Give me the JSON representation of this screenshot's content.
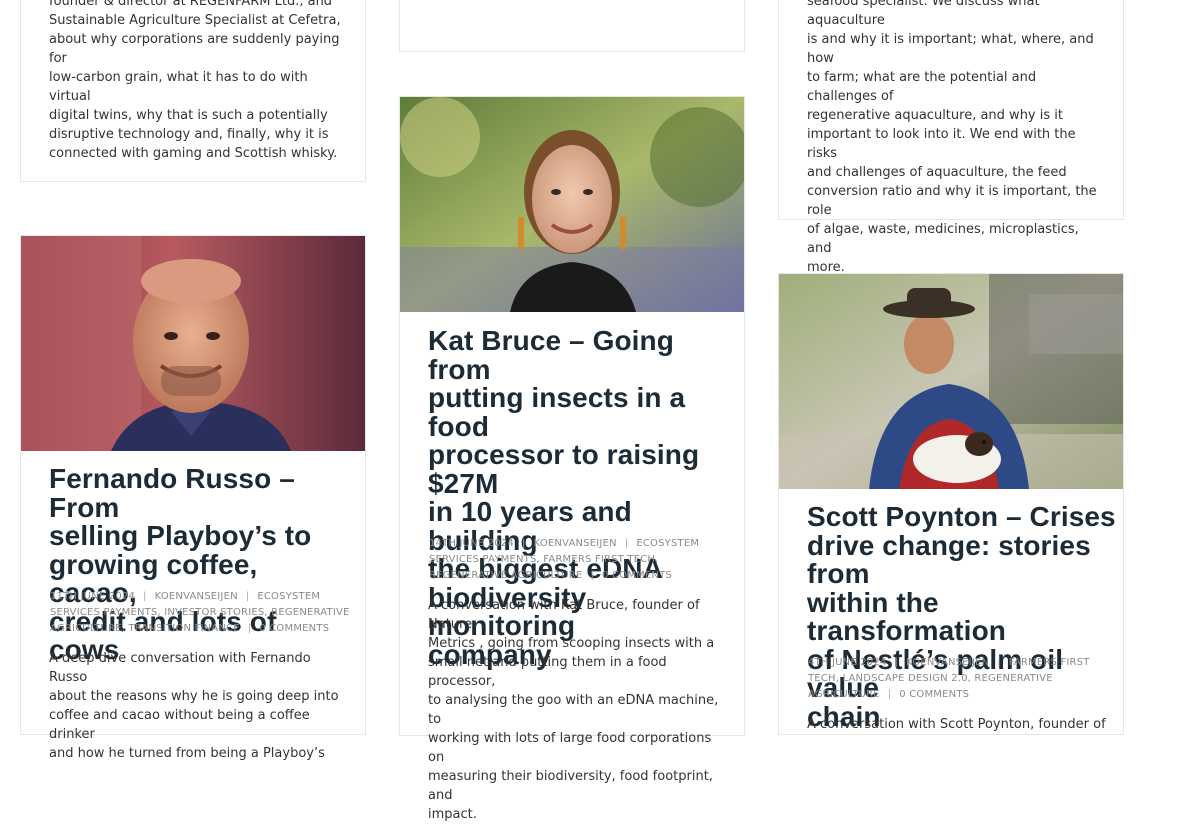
{
  "posts": [
    {
      "excerpt_lines": [
        "founder & director at REGENFARM Ltd., and",
        "Sustainable Agriculture Specialist at Cefetra,",
        "about why corporations are suddenly paying for",
        "low-carbon grain, what it has to do with virtual",
        "digital twins, why that is such a potentially",
        "disruptive technology and, finally, why it is",
        "connected with gaming and Scottish whisky."
      ]
    },
    {
      "excerpt_lines": [
        "seafood specialist. We discuss what aquaculture",
        "is and why it is important; what, where, and how",
        "to farm; what are the potential and challenges of",
        "regenerative aquaculture, and why is it",
        "important to look into it. We end with the risks",
        "and challenges of aquaculture, the feed",
        "conversion ratio and why it is important, the role",
        "of algae, waste, medicines, microplastics, and",
        "more."
      ]
    },
    {
      "title_lines": [
        "Fernando Russo – From",
        "selling Playboy’s to",
        "growing coffee, cacao,",
        "credit and lots of cows"
      ],
      "date": "11th June 2024",
      "author": "koenvanseijen",
      "categories_lines": [
        "Ecosystem",
        "Services Payments, Investor Stories, Regenerative",
        "Agriculture, Transition Finance"
      ],
      "comments": "0 Comments",
      "excerpt_lines": [
        "A deep dive conversation with Fernando Russo",
        "about the reasons why he is going deep into",
        "coffee and cacao without being a coffee drinker",
        "and how he turned from being a Playboy’s"
      ]
    },
    {
      "title_lines": [
        "Kat Bruce – Going from",
        "putting insects in a food",
        "processor to raising $27M",
        "in 10 years and building",
        "the biggest eDNA",
        "biodiversity monitoring",
        "company"
      ],
      "date": "14th June 2024",
      "author": "koenvanseijen",
      "categories_lines": [
        "Ecosystem",
        "Services Payments, Farmers First Tech,",
        "Regenerative Agriculture"
      ],
      "comments": "0 Comments",
      "excerpt_lines": [
        "A conversation with Kat Bruce, founder of Nature",
        "Metrics , going from scooping insects with a",
        "small net and putting them in a food processor,",
        "to analysing the goo with an eDNA machine, to",
        "working with lots of large food corporations on",
        "measuring their biodiversity, food footprint, and",
        "impact."
      ]
    },
    {
      "title_lines": [
        "Scott Poynton – Crises",
        "drive change: stories from",
        "within the transformation",
        "of Nestlé’s palm oil value",
        "chain"
      ],
      "date": "4th June 2024",
      "author": "koenvanseijen",
      "categories_lines": [
        "Farmers First",
        "Tech, Landscape Design 2.0, Regenerative",
        "Agriculture"
      ],
      "comments": "0 Comments",
      "excerpt_lines": [
        "A conversation with Scott Poynton, founder of"
      ]
    }
  ]
}
